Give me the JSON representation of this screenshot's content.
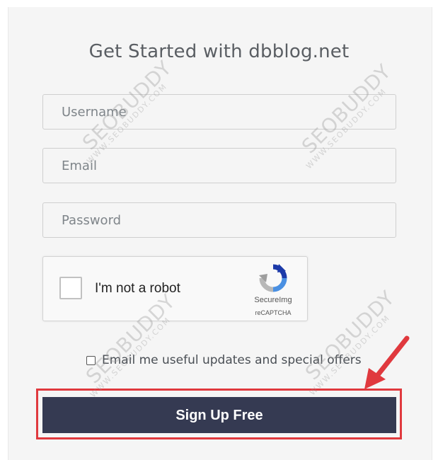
{
  "form": {
    "title": "Get Started with dbblog.net",
    "username_placeholder": "Username",
    "email_placeholder": "Email",
    "password_placeholder": "Password",
    "optin_label": "Email me useful updates and special offers",
    "submit_label": "Sign Up Free"
  },
  "recaptcha": {
    "label": "I'm not a robot",
    "brand": "SecureImg",
    "sub": "reCAPTCHA"
  },
  "watermark": {
    "brand": "SEOBUDDY",
    "site": "WWW.SEOBUDDY.COM"
  },
  "colors": {
    "submit_bg": "#353a52",
    "highlight": "#e0393e",
    "arrow": "#e0393e"
  }
}
